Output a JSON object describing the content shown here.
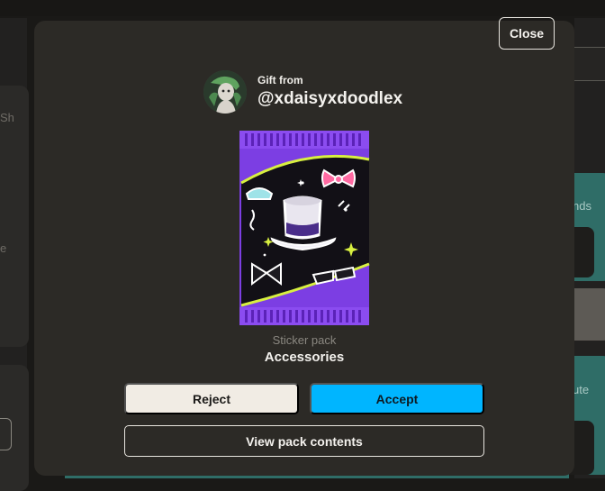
{
  "background": {
    "peek_texts": [
      "Sh",
      "nds",
      "ute",
      "e"
    ]
  },
  "modal": {
    "close_label": "Close",
    "gift_from_label": "Gift from",
    "username": "@xdaisyxdoodlex",
    "pack_type": "Sticker pack",
    "pack_name": "Accessories",
    "reject_label": "Reject",
    "accept_label": "Accept",
    "view_label": "View pack contents"
  },
  "colors": {
    "accent": "#00b5ff",
    "modal_bg": "#2c2a26",
    "pack_purple": "#7b3fe4"
  }
}
